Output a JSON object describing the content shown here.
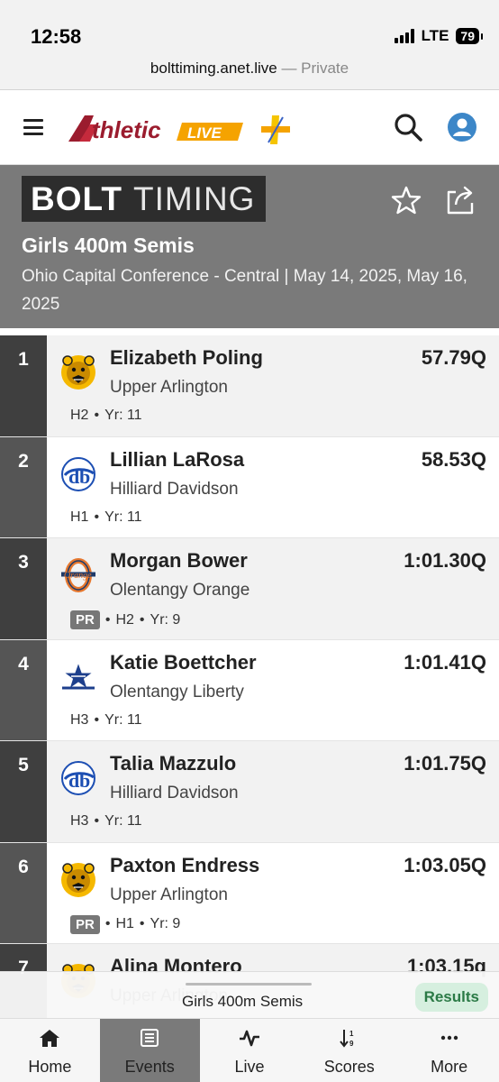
{
  "status_bar": {
    "time": "12:58",
    "network": "LTE",
    "battery": "79"
  },
  "browser": {
    "url": "bolttiming.anet.live",
    "separator": " — ",
    "mode": "Private"
  },
  "header": {
    "logo_text": "AthleticLIVE",
    "icons": [
      "menu-icon",
      "search-icon",
      "user-icon"
    ]
  },
  "event": {
    "brand_bold": "BOLT",
    "brand_light": "TIMING",
    "title": "Girls 400m Semis",
    "subtitle": "Ohio Capital Conference - Central | May 14, 2025, May 16, 2025"
  },
  "results": [
    {
      "place": "1",
      "name": "Elizabeth Poling",
      "school": "Upper Arlington",
      "pr": false,
      "pr_label": "",
      "heat": "H2",
      "year": "Yr: 11",
      "mark": "57.79Q",
      "logo": "bear-logo"
    },
    {
      "place": "2",
      "name": "Lillian LaRosa",
      "school": "Hilliard Davidson",
      "pr": false,
      "pr_label": "",
      "heat": "H1",
      "year": "Yr: 11",
      "mark": "58.53Q",
      "logo": "hd-logo"
    },
    {
      "place": "3",
      "name": "Morgan Bower",
      "school": "Olentangy Orange",
      "pr": true,
      "pr_label": "PR",
      "heat": "H2",
      "year": "Yr: 9",
      "mark": "1:01.30Q",
      "logo": "orange-o-logo"
    },
    {
      "place": "4",
      "name": "Katie Boettcher",
      "school": "Olentangy Liberty",
      "pr": false,
      "pr_label": "",
      "heat": "H3",
      "year": "Yr: 11",
      "mark": "1:01.41Q",
      "logo": "star-logo"
    },
    {
      "place": "5",
      "name": "Talia Mazzulo",
      "school": "Hilliard Davidson",
      "pr": false,
      "pr_label": "",
      "heat": "H3",
      "year": "Yr: 11",
      "mark": "1:01.75Q",
      "logo": "hd-logo"
    },
    {
      "place": "6",
      "name": "Paxton Endress",
      "school": "Upper Arlington",
      "pr": true,
      "pr_label": "PR",
      "heat": "H1",
      "year": "Yr: 9",
      "mark": "1:03.05Q",
      "logo": "bear-logo"
    },
    {
      "place": "7",
      "name": "Alina Montero",
      "school": "Upper Arlington",
      "pr": false,
      "pr_label": "",
      "heat": "",
      "year": "",
      "mark": "1:03.15q",
      "logo": "bear-logo"
    }
  ],
  "event_bar": {
    "title": "Girls 400m Semis",
    "button": "Results"
  },
  "bottom_nav": [
    {
      "label": "Home",
      "icon": "home-icon",
      "active": false
    },
    {
      "label": "Events",
      "icon": "list-icon",
      "active": true
    },
    {
      "label": "Live",
      "icon": "pulse-icon",
      "active": false
    },
    {
      "label": "Scores",
      "icon": "sort-icon",
      "active": false
    },
    {
      "label": "More",
      "icon": "more-icon",
      "active": false
    }
  ],
  "colors": {
    "banner": "#7a7a7a",
    "place_dark": "#3f3f3f",
    "results_green": "#2b7a46",
    "logo_red": "#9b1c2e",
    "logo_orange": "#f5a300"
  }
}
